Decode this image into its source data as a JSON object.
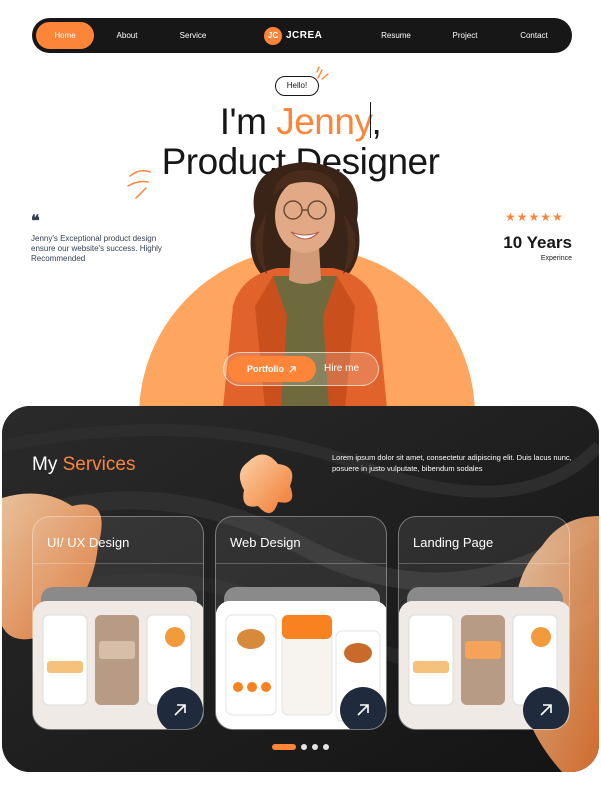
{
  "nav": {
    "items": [
      {
        "label": "Home",
        "active": true
      },
      {
        "label": "About"
      },
      {
        "label": "Service"
      },
      {
        "label": "Resume"
      },
      {
        "label": "Project"
      },
      {
        "label": "Contact"
      }
    ],
    "logo_mark": "JC",
    "logo_text": "JCREA"
  },
  "hero": {
    "greeting": "Hello!",
    "headline_prefix": "I'm ",
    "headline_name": "Jenny",
    "headline_suffix": ",",
    "headline_line2": "Product Designer",
    "quote_icon": "❝",
    "testimonial": "Jenny's Exceptional product design ensure our website's success. Highly Recommended",
    "stars": "★★★★★",
    "rating_value": 5,
    "experience_value": "10 Years",
    "experience_label": "Experince",
    "primary_cta": "Portfolio",
    "secondary_cta": "Hire me"
  },
  "services": {
    "title_prefix": "My ",
    "title_accent": "Services",
    "description": "Lorem ipsum dolor sit amet, consectetur adipiscing elit. Duis lacus nunc, posuere in justo vulputate, bibendum sodales",
    "cards": [
      {
        "title": "UI/ UX Design"
      },
      {
        "title": "Web Design"
      },
      {
        "title": "Landing Page"
      }
    ],
    "pagination": {
      "total": 4,
      "active": 1
    }
  },
  "colors": {
    "accent": "#fd853a",
    "dark": "#171717",
    "peach": "#fea55f",
    "arrow_button": "#1f2b3c"
  }
}
